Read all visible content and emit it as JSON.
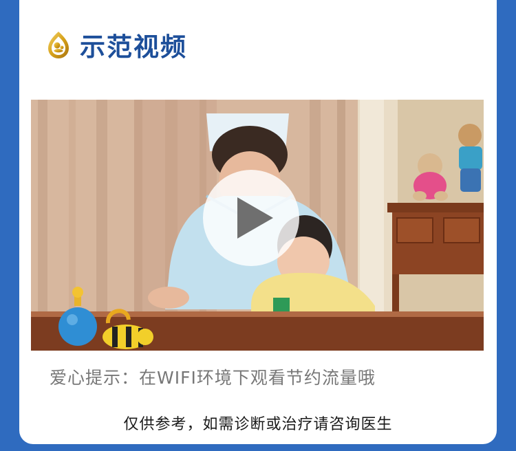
{
  "section": {
    "title": "示范视频",
    "icon": "mother-baby-logo-icon"
  },
  "video": {
    "play_icon": "play-icon"
  },
  "tip_text": "爱心提示：在WIFI环境下观看节约流量哦",
  "disclaimer_text": "仅供参考，如需诊断或治疗请咨询医生",
  "colors": {
    "background": "#2f6bbf",
    "title": "#1d4f9a",
    "logo_gold": "#d7a21b",
    "tip_text": "#777777",
    "disclaimer_text": "#1a1a1a"
  }
}
